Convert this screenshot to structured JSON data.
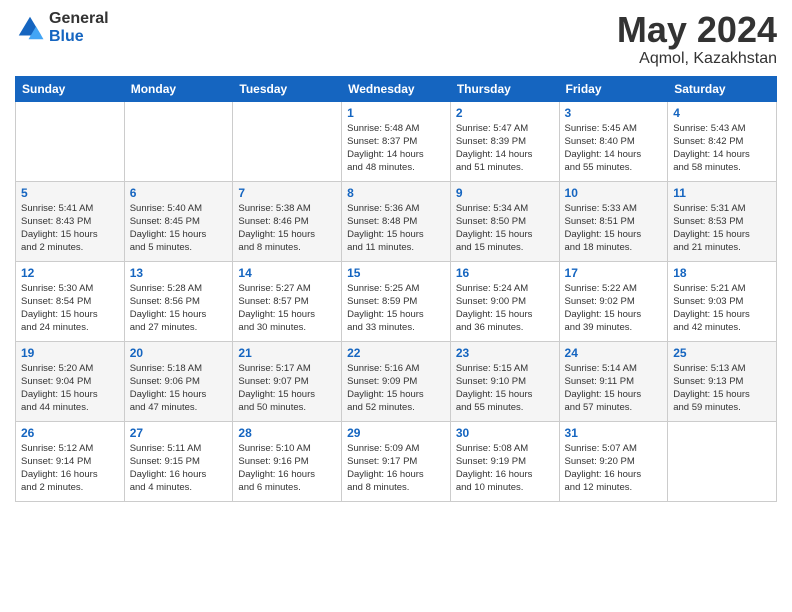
{
  "logo": {
    "general": "General",
    "blue": "Blue"
  },
  "title": {
    "month_year": "May 2024",
    "location": "Aqmol, Kazakhstan"
  },
  "weekdays": [
    "Sunday",
    "Monday",
    "Tuesday",
    "Wednesday",
    "Thursday",
    "Friday",
    "Saturday"
  ],
  "weeks": [
    [
      {
        "day": "",
        "info": ""
      },
      {
        "day": "",
        "info": ""
      },
      {
        "day": "",
        "info": ""
      },
      {
        "day": "1",
        "info": "Sunrise: 5:48 AM\nSunset: 8:37 PM\nDaylight: 14 hours\nand 48 minutes."
      },
      {
        "day": "2",
        "info": "Sunrise: 5:47 AM\nSunset: 8:39 PM\nDaylight: 14 hours\nand 51 minutes."
      },
      {
        "day": "3",
        "info": "Sunrise: 5:45 AM\nSunset: 8:40 PM\nDaylight: 14 hours\nand 55 minutes."
      },
      {
        "day": "4",
        "info": "Sunrise: 5:43 AM\nSunset: 8:42 PM\nDaylight: 14 hours\nand 58 minutes."
      }
    ],
    [
      {
        "day": "5",
        "info": "Sunrise: 5:41 AM\nSunset: 8:43 PM\nDaylight: 15 hours\nand 2 minutes."
      },
      {
        "day": "6",
        "info": "Sunrise: 5:40 AM\nSunset: 8:45 PM\nDaylight: 15 hours\nand 5 minutes."
      },
      {
        "day": "7",
        "info": "Sunrise: 5:38 AM\nSunset: 8:46 PM\nDaylight: 15 hours\nand 8 minutes."
      },
      {
        "day": "8",
        "info": "Sunrise: 5:36 AM\nSunset: 8:48 PM\nDaylight: 15 hours\nand 11 minutes."
      },
      {
        "day": "9",
        "info": "Sunrise: 5:34 AM\nSunset: 8:50 PM\nDaylight: 15 hours\nand 15 minutes."
      },
      {
        "day": "10",
        "info": "Sunrise: 5:33 AM\nSunset: 8:51 PM\nDaylight: 15 hours\nand 18 minutes."
      },
      {
        "day": "11",
        "info": "Sunrise: 5:31 AM\nSunset: 8:53 PM\nDaylight: 15 hours\nand 21 minutes."
      }
    ],
    [
      {
        "day": "12",
        "info": "Sunrise: 5:30 AM\nSunset: 8:54 PM\nDaylight: 15 hours\nand 24 minutes."
      },
      {
        "day": "13",
        "info": "Sunrise: 5:28 AM\nSunset: 8:56 PM\nDaylight: 15 hours\nand 27 minutes."
      },
      {
        "day": "14",
        "info": "Sunrise: 5:27 AM\nSunset: 8:57 PM\nDaylight: 15 hours\nand 30 minutes."
      },
      {
        "day": "15",
        "info": "Sunrise: 5:25 AM\nSunset: 8:59 PM\nDaylight: 15 hours\nand 33 minutes."
      },
      {
        "day": "16",
        "info": "Sunrise: 5:24 AM\nSunset: 9:00 PM\nDaylight: 15 hours\nand 36 minutes."
      },
      {
        "day": "17",
        "info": "Sunrise: 5:22 AM\nSunset: 9:02 PM\nDaylight: 15 hours\nand 39 minutes."
      },
      {
        "day": "18",
        "info": "Sunrise: 5:21 AM\nSunset: 9:03 PM\nDaylight: 15 hours\nand 42 minutes."
      }
    ],
    [
      {
        "day": "19",
        "info": "Sunrise: 5:20 AM\nSunset: 9:04 PM\nDaylight: 15 hours\nand 44 minutes."
      },
      {
        "day": "20",
        "info": "Sunrise: 5:18 AM\nSunset: 9:06 PM\nDaylight: 15 hours\nand 47 minutes."
      },
      {
        "day": "21",
        "info": "Sunrise: 5:17 AM\nSunset: 9:07 PM\nDaylight: 15 hours\nand 50 minutes."
      },
      {
        "day": "22",
        "info": "Sunrise: 5:16 AM\nSunset: 9:09 PM\nDaylight: 15 hours\nand 52 minutes."
      },
      {
        "day": "23",
        "info": "Sunrise: 5:15 AM\nSunset: 9:10 PM\nDaylight: 15 hours\nand 55 minutes."
      },
      {
        "day": "24",
        "info": "Sunrise: 5:14 AM\nSunset: 9:11 PM\nDaylight: 15 hours\nand 57 minutes."
      },
      {
        "day": "25",
        "info": "Sunrise: 5:13 AM\nSunset: 9:13 PM\nDaylight: 15 hours\nand 59 minutes."
      }
    ],
    [
      {
        "day": "26",
        "info": "Sunrise: 5:12 AM\nSunset: 9:14 PM\nDaylight: 16 hours\nand 2 minutes."
      },
      {
        "day": "27",
        "info": "Sunrise: 5:11 AM\nSunset: 9:15 PM\nDaylight: 16 hours\nand 4 minutes."
      },
      {
        "day": "28",
        "info": "Sunrise: 5:10 AM\nSunset: 9:16 PM\nDaylight: 16 hours\nand 6 minutes."
      },
      {
        "day": "29",
        "info": "Sunrise: 5:09 AM\nSunset: 9:17 PM\nDaylight: 16 hours\nand 8 minutes."
      },
      {
        "day": "30",
        "info": "Sunrise: 5:08 AM\nSunset: 9:19 PM\nDaylight: 16 hours\nand 10 minutes."
      },
      {
        "day": "31",
        "info": "Sunrise: 5:07 AM\nSunset: 9:20 PM\nDaylight: 16 hours\nand 12 minutes."
      },
      {
        "day": "",
        "info": ""
      }
    ]
  ]
}
